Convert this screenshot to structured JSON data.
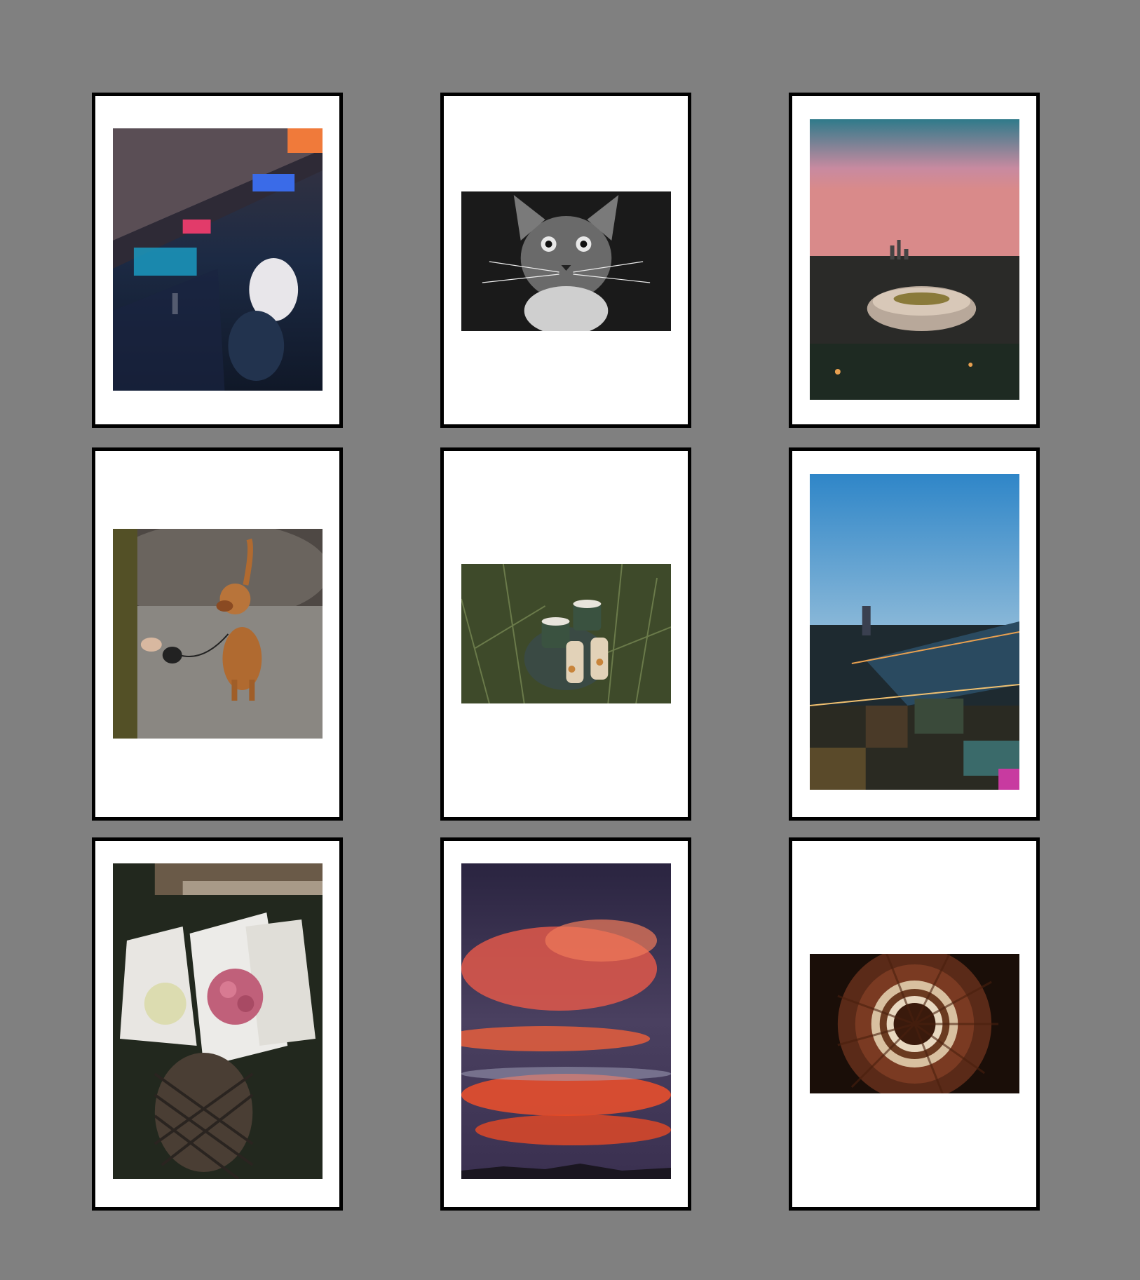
{
  "page": {
    "background": "#808080",
    "frame_color": "#000000",
    "mat_color": "#ffffff"
  },
  "gallery": {
    "photos": [
      {
        "subject": "neon-street-night",
        "orientation": "portrait"
      },
      {
        "subject": "black-white-cat",
        "orientation": "landscape"
      },
      {
        "subject": "stadium-city-dusk",
        "orientation": "portrait"
      },
      {
        "subject": "dachshund-on-leash",
        "orientation": "square"
      },
      {
        "subject": "coffee-cups-in-grass",
        "orientation": "landscape"
      },
      {
        "subject": "city-bridge-aerial-night",
        "orientation": "portrait"
      },
      {
        "subject": "rose-bouquets-basket",
        "orientation": "portrait"
      },
      {
        "subject": "red-sunset-clouds",
        "orientation": "portrait"
      },
      {
        "subject": "spiral-staircase",
        "orientation": "landscape"
      }
    ]
  }
}
